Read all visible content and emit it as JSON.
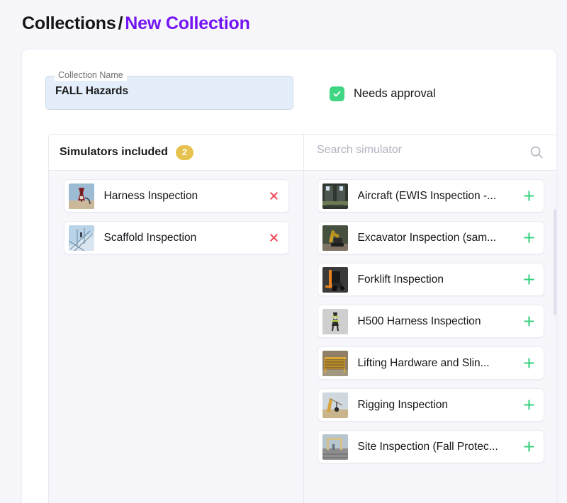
{
  "header": {
    "root": "Collections",
    "separator": "/",
    "current": "New Collection"
  },
  "form": {
    "collection_name_label": "Collection Name",
    "collection_name_value": "FALL Hazards",
    "collection_name_placeholder": "Collection Name",
    "needs_approval_label": "Needs approval",
    "needs_approval_checked": "true",
    "check_icon": "check-icon"
  },
  "included_panel": {
    "title": "Simulators included",
    "count": "2",
    "remove_icon": "close-icon",
    "items": [
      {
        "label": "Harness Inspection",
        "thumb": "harness-thumb"
      },
      {
        "label": "Scaffold Inspection",
        "thumb": "scaffold-thumb"
      }
    ]
  },
  "available_panel": {
    "search_placeholder": "Search simulator",
    "search_value": "",
    "search_icon": "search-icon",
    "add_icon": "plus-icon",
    "items": [
      {
        "label": "Aircraft (EWIS Inspection -...",
        "thumb": "aircraft-thumb"
      },
      {
        "label": "Excavator Inspection (sam...",
        "thumb": "excavator-thumb"
      },
      {
        "label": "Forklift Inspection",
        "thumb": "forklift-thumb"
      },
      {
        "label": "H500 Harness Inspection",
        "thumb": "h500-thumb"
      },
      {
        "label": "Lifting Hardware and Slin...",
        "thumb": "lifting-thumb"
      },
      {
        "label": "Rigging Inspection",
        "thumb": "rigging-thumb"
      },
      {
        "label": "Site Inspection (Fall Protec...",
        "thumb": "site-thumb"
      }
    ]
  },
  "colors": {
    "accent_purple": "#7214f4",
    "badge_yellow": "#e8c24e",
    "checkbox_green": "#3ed683",
    "add_green": "#35d07f",
    "remove_red": "#ef4a5c",
    "page_bg": "#f7f6fb",
    "field_bg": "#e4edfa"
  }
}
